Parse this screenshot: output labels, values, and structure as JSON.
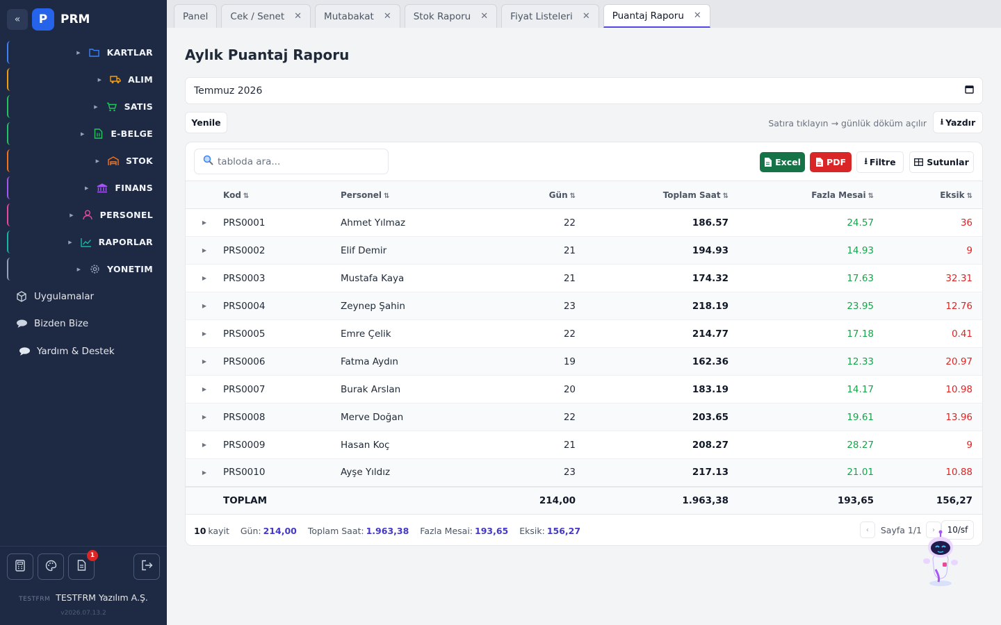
{
  "sidebar": {
    "collapse_icon": "«",
    "logo_letter": "P",
    "logo_text": "PRM",
    "items": [
      {
        "label": "KARTLAR",
        "color": "#3b82f6",
        "icon": "folder-icon"
      },
      {
        "label": "ALIM",
        "color": "#f59e0b",
        "icon": "truck-icon"
      },
      {
        "label": "SATIS",
        "color": "#22c55e",
        "icon": "cart-icon"
      },
      {
        "label": "E-BELGE",
        "color": "#22c55e",
        "icon": "e-document-icon"
      },
      {
        "label": "STOK",
        "color": "#f97316",
        "icon": "warehouse-icon"
      },
      {
        "label": "FINANS",
        "color": "#a855f7",
        "icon": "bank-icon"
      },
      {
        "label": "PERSONEL",
        "color": "#ec4899",
        "icon": "person-icon"
      },
      {
        "label": "RAPORLAR",
        "color": "#14b8a6",
        "icon": "chart-line-icon"
      },
      {
        "label": "YONETIM",
        "color": "#94a3b8",
        "icon": "gear-icon"
      }
    ],
    "links": [
      {
        "label": "Uygulamalar",
        "icon": "cube-icon"
      },
      {
        "label": "Bizden Bize",
        "icon": "chat-icon"
      },
      {
        "label": "Yardım & Destek",
        "icon": "support-bubble-icon"
      }
    ],
    "notification_count": "1",
    "company_code": "TESTFRM",
    "company_name": "TESTFRM Yazılım A.Ş.",
    "version": "v2026.07.13.2"
  },
  "tabs": [
    {
      "label": "Panel",
      "closable": false,
      "active": false
    },
    {
      "label": "Cek / Senet",
      "closable": true,
      "active": false
    },
    {
      "label": "Mutabakat",
      "closable": true,
      "active": false
    },
    {
      "label": "Stok Raporu",
      "closable": true,
      "active": false
    },
    {
      "label": "Fiyat Listeleri",
      "closable": true,
      "active": false
    },
    {
      "label": "Puantaj Raporu",
      "closable": true,
      "active": true
    }
  ],
  "page": {
    "title": "Aylık Puantaj Raporu",
    "month_value": "Temmuz  2026",
    "refresh_label": "Yenile",
    "hint": "Satıra tıklayın → günlük döküm açılır",
    "print_label": "Yazdır"
  },
  "toolbar": {
    "search_placeholder": "tabloda ara...",
    "excel_label": "Excel",
    "pdf_label": "PDF",
    "filter_label": "Filtre",
    "columns_label": "Sutunlar"
  },
  "table": {
    "headers": {
      "kod": "Kod",
      "personel": "Personel",
      "gun": "Gün",
      "toplam": "Toplam Saat",
      "fazla": "Fazla Mesai",
      "eksik": "Eksik"
    },
    "rows": [
      {
        "kod": "PRS0001",
        "personel": "Ahmet Yılmaz",
        "gun": "22",
        "toplam": "186.57",
        "fazla": "24.57",
        "eksik": "36"
      },
      {
        "kod": "PRS0002",
        "personel": "Elif Demir",
        "gun": "21",
        "toplam": "194.93",
        "fazla": "14.93",
        "eksik": "9"
      },
      {
        "kod": "PRS0003",
        "personel": "Mustafa Kaya",
        "gun": "21",
        "toplam": "174.32",
        "fazla": "17.63",
        "eksik": "32.31"
      },
      {
        "kod": "PRS0004",
        "personel": "Zeynep Şahin",
        "gun": "23",
        "toplam": "218.19",
        "fazla": "23.95",
        "eksik": "12.76"
      },
      {
        "kod": "PRS0005",
        "personel": "Emre Çelik",
        "gun": "22",
        "toplam": "214.77",
        "fazla": "17.18",
        "eksik": "0.41"
      },
      {
        "kod": "PRS0006",
        "personel": "Fatma Aydın",
        "gun": "19",
        "toplam": "162.36",
        "fazla": "12.33",
        "eksik": "20.97"
      },
      {
        "kod": "PRS0007",
        "personel": "Burak Arslan",
        "gun": "20",
        "toplam": "183.19",
        "fazla": "14.17",
        "eksik": "10.98"
      },
      {
        "kod": "PRS0008",
        "personel": "Merve Doğan",
        "gun": "22",
        "toplam": "203.65",
        "fazla": "19.61",
        "eksik": "13.96"
      },
      {
        "kod": "PRS0009",
        "personel": "Hasan Koç",
        "gun": "21",
        "toplam": "208.27",
        "fazla": "28.27",
        "eksik": "9"
      },
      {
        "kod": "PRS0010",
        "personel": "Ayşe Yıldız",
        "gun": "23",
        "toplam": "217.13",
        "fazla": "21.01",
        "eksik": "10.88"
      }
    ],
    "total": {
      "label": "TOPLAM",
      "gun": "214,00",
      "toplam": "1.963,38",
      "fazla": "193,65",
      "eksik": "156,27"
    }
  },
  "footer": {
    "count": "10",
    "count_label": "kayit",
    "gun_label": "Gün:",
    "gun_value": "214,00",
    "toplam_label": "Toplam Saat:",
    "toplam_value": "1.963,38",
    "fazla_label": "Fazla Mesai:",
    "fazla_value": "193,65",
    "eksik_label": "Eksik:",
    "eksik_value": "156,27",
    "page_info": "Sayfa 1/1",
    "page_size": "10/sf"
  }
}
